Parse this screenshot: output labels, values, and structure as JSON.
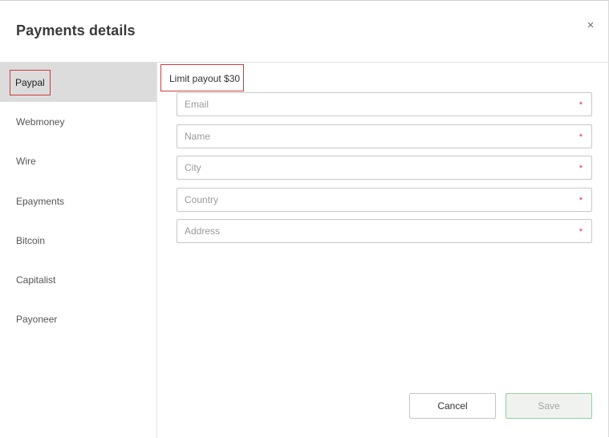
{
  "dialog": {
    "title": "Payments details",
    "close_icon": "close-icon",
    "close_glyph": "×"
  },
  "sidebar": {
    "items": [
      {
        "label": "Paypal",
        "active": true
      },
      {
        "label": "Webmoney",
        "active": false
      },
      {
        "label": "Wire",
        "active": false
      },
      {
        "label": "Epayments",
        "active": false
      },
      {
        "label": "Bitcoin",
        "active": false
      },
      {
        "label": "Capitalist",
        "active": false
      },
      {
        "label": "Payoneer",
        "active": false
      }
    ]
  },
  "main": {
    "limit_text": "Limit payout $30",
    "fields": [
      {
        "placeholder": "Email",
        "value": "",
        "required": true
      },
      {
        "placeholder": "Name",
        "value": "",
        "required": true
      },
      {
        "placeholder": "City",
        "value": "",
        "required": true
      },
      {
        "placeholder": "Country",
        "value": "",
        "required": true
      },
      {
        "placeholder": "Address",
        "value": "",
        "required": true
      }
    ],
    "required_mark": "*"
  },
  "footer": {
    "cancel_label": "Cancel",
    "save_label": "Save"
  },
  "colors": {
    "highlight_outline": "#d23b3b",
    "active_item_bg": "#dcdcdc",
    "required_star": "#d23b3b",
    "save_border": "#8fd49a"
  }
}
